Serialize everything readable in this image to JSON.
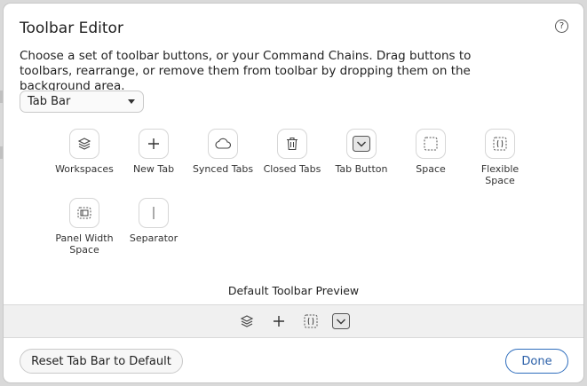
{
  "dialog": {
    "title": "Toolbar Editor",
    "help_icon": "question-circle-icon",
    "description": "Choose a set of toolbar buttons, or your Command Chains. Drag buttons to toolbars, rearrange, or remove them from toolbar by dropping them on the background area."
  },
  "dropdown": {
    "selected": "Tab Bar"
  },
  "tools": [
    {
      "label": "Workspaces",
      "icon": "layers-icon"
    },
    {
      "label": "New Tab",
      "icon": "plus-icon"
    },
    {
      "label": "Synced Tabs",
      "icon": "cloud-icon"
    },
    {
      "label": "Closed Tabs",
      "icon": "trash-icon"
    },
    {
      "label": "Tab Button",
      "icon": "chevron-down-icon"
    },
    {
      "label": "Space",
      "icon": "dashed-square-icon"
    },
    {
      "label": "Flexible\nSpace",
      "icon": "flexible-space-icon"
    },
    {
      "label": "Panel Width\nSpace",
      "icon": "panel-width-space-icon"
    },
    {
      "label": "Separator",
      "icon": "separator-icon"
    }
  ],
  "preview": {
    "label": "Default Toolbar Preview",
    "items": [
      "layers-icon",
      "plus-icon",
      "flexible-space-icon",
      "chevron-down-icon"
    ]
  },
  "footer": {
    "reset_label": "Reset Tab Bar to Default",
    "done_label": "Done"
  }
}
